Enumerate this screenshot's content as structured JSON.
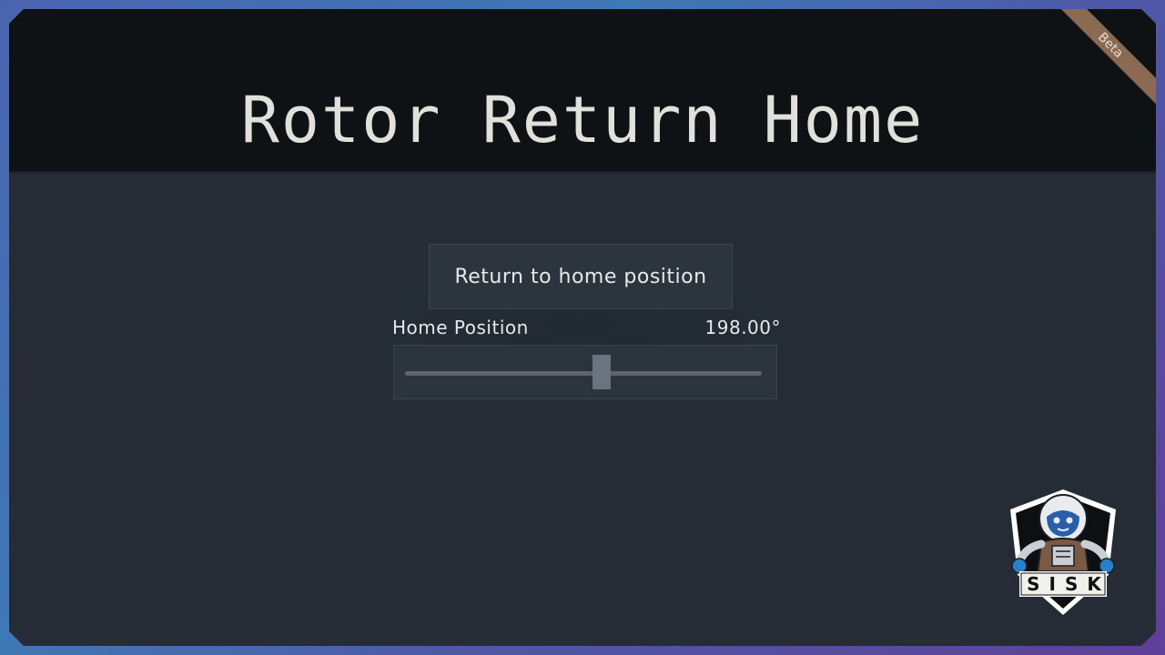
{
  "header": {
    "title": "Rotor Return Home",
    "badge": "Beta"
  },
  "actions": {
    "return_home_label": "Return to home position"
  },
  "home_position": {
    "label": "Home Position",
    "value_text": "198.00°",
    "value_deg": 198.0,
    "fraction": 0.55
  },
  "logo": {
    "text": "SISK",
    "icon": "astronaut-shield-icon"
  },
  "colors": {
    "header_bg": "#0f1215",
    "body_bg": "#252c36",
    "badge_bg": "#8a6a52",
    "control_bg": "#2c353d",
    "text": "#e6e8ea"
  }
}
